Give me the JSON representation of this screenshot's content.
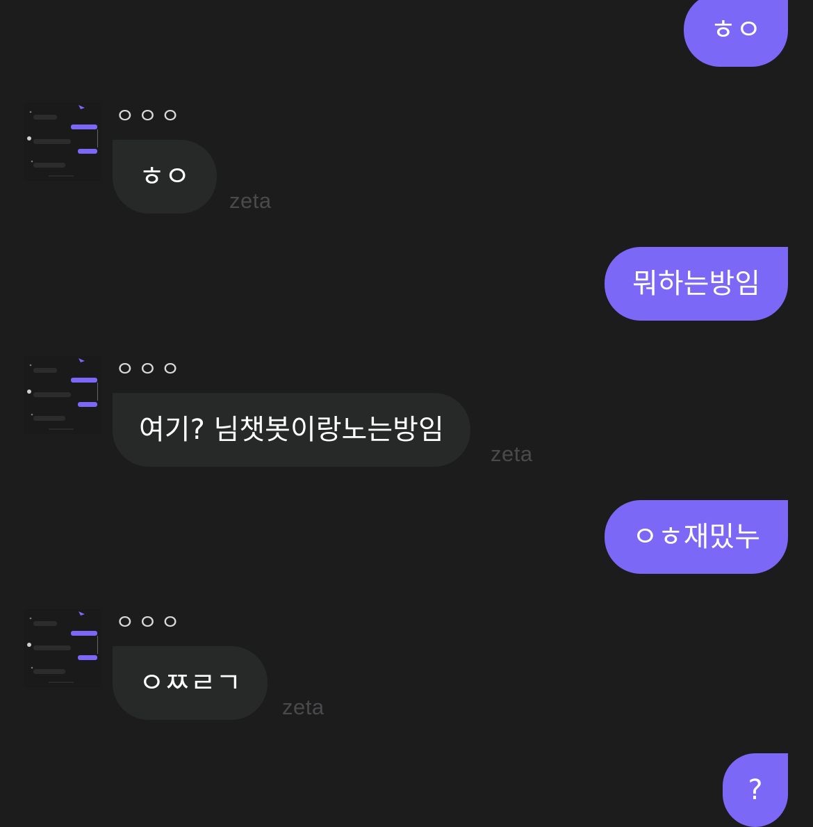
{
  "messages": [
    {
      "role": "user",
      "text": "ㅎㅇ"
    },
    {
      "role": "bot",
      "sender": "ㅇㅇㅇ",
      "text": "ㅎㅇ"
    },
    {
      "role": "user",
      "text": "뭐하는방임"
    },
    {
      "role": "bot",
      "sender": "ㅇㅇㅇ",
      "text": "여기? 님챗봇이랑노는방임"
    },
    {
      "role": "user",
      "text": "ㅇㅎ재밌누"
    },
    {
      "role": "bot",
      "sender": "ㅇㅇㅇ",
      "text": "ㅇㅉㄹㄱ"
    },
    {
      "role": "user",
      "text": "?"
    }
  ],
  "watermark": "zeta",
  "colors": {
    "background": "#1c1c1d",
    "user_bubble": "#7b68f7",
    "bot_bubble": "#272828"
  },
  "icons": {
    "avatar": "chat-screenshot-thumbnail"
  }
}
